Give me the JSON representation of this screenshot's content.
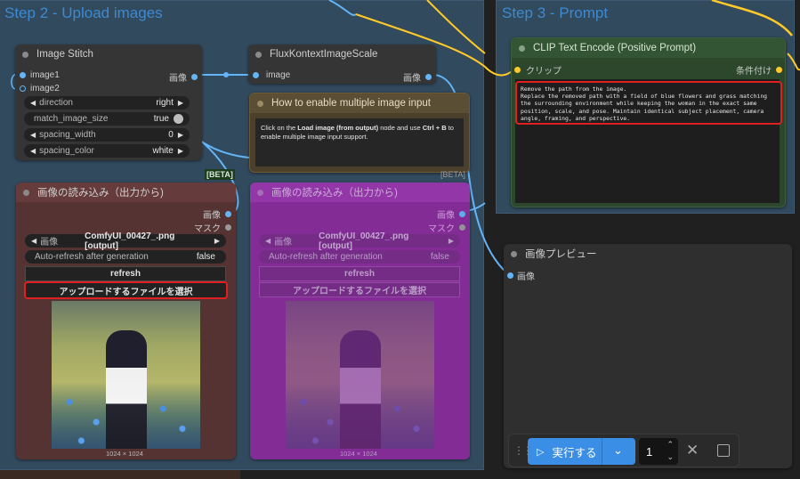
{
  "groups": {
    "step2": "Step 2 - Upload images",
    "step3": "Step 3 - Prompt"
  },
  "image_stitch": {
    "title": "Image Stitch",
    "inputs": [
      "image1",
      "image2"
    ],
    "output": "画像",
    "widgets": [
      {
        "label": "direction",
        "value": "right",
        "type": "combo"
      },
      {
        "label": "match_image_size",
        "value": "true",
        "type": "toggle"
      },
      {
        "label": "spacing_width",
        "value": "0",
        "type": "number"
      },
      {
        "label": "spacing_color",
        "value": "white",
        "type": "combo"
      }
    ]
  },
  "flux_scale": {
    "title": "FluxKontextImageScale",
    "input": "image",
    "output": "画像"
  },
  "note": {
    "title": "How to enable multiple image input",
    "text_pre": "Click on the ",
    "text_bold1": "Load image (from output)",
    "text_mid": " node and use ",
    "text_bold2": "Ctrl + B",
    "text_post": " to enable multiple image input support."
  },
  "beta_badge": "[BETA]",
  "load_image_left": {
    "title": "画像の読み込み（出力から)",
    "outputs": [
      "画像",
      "マスク"
    ],
    "image_label": "画像",
    "image_value": "ComfyUI_00427_.png [output]",
    "auto_refresh_label": "Auto-refresh after generation",
    "auto_refresh_value": "false",
    "refresh_label": "refresh",
    "upload_label": "アップロードするファイルを選択",
    "dims": "1024 × 1024"
  },
  "load_image_right": {
    "title": "画像の読み込み（出力から)",
    "outputs": [
      "画像",
      "マスク"
    ],
    "image_label": "画像",
    "image_value": "ComfyUI_00427_.png [output]",
    "auto_refresh_label": "Auto-refresh after generation",
    "auto_refresh_value": "false",
    "refresh_label": "refresh",
    "upload_label": "アップロードするファイルを選択",
    "dims": "1024 × 1024"
  },
  "clip": {
    "title": "CLIP Text Encode (Positive Prompt)",
    "input": "クリップ",
    "output": "条件付け",
    "prompt": "Remove the path from the image.\nReplace the removed path with a field of blue flowers and grass matching the surrounding environment while keeping the woman in the exact same position, scale, and pose. Maintain identical subject placement, camera angle, framing, and perspective."
  },
  "preview": {
    "title": "画像プレビュー",
    "input": "画像"
  },
  "toolbar": {
    "run_label": "実行する",
    "count": "1"
  },
  "colors": {
    "group": "#324a5e",
    "group_title": "#3d8ad1",
    "wire_blue": "#64b5f6",
    "wire_yellow": "#ffca28",
    "highlight_red": "#e02020",
    "run_button": "#3a8ee6",
    "bypass_purple": "#8a2a9a"
  }
}
